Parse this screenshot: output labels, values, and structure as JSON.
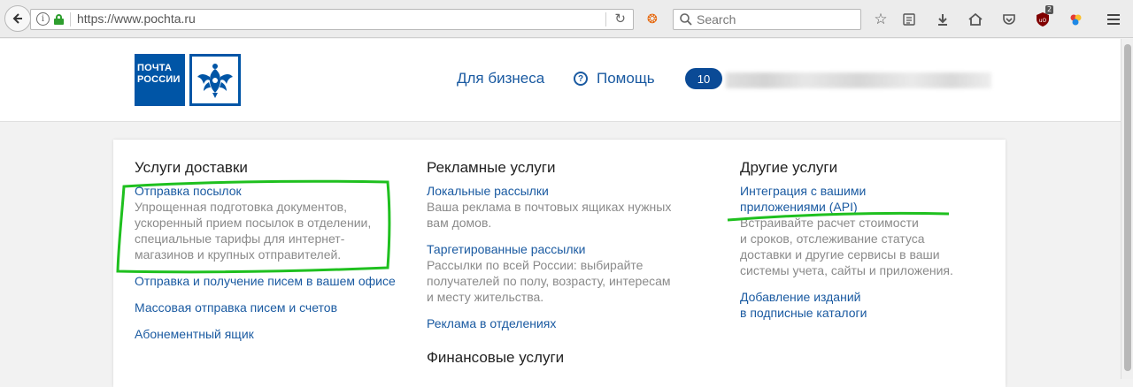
{
  "browser": {
    "url": "https://www.pochta.ru",
    "search_placeholder": "Search",
    "ublock_count": "2"
  },
  "header": {
    "logo_text_line1": "ПОЧТА",
    "logo_text_line2": "РОССИИ",
    "nav_business": "Для бизнеса",
    "nav_help": "Помощь",
    "notification_count": "10"
  },
  "columns": [
    {
      "heading": "Услуги доставки",
      "items": [
        {
          "label": "Отправка посылок",
          "desc": [
            "Упрощенная подготовка документов,",
            "ускоренный прием посылок в отделении,",
            "специальные тарифы для интернет-",
            "магазинов и крупных отправителей."
          ]
        },
        {
          "label": "Отправка и получение писем в вашем офисе"
        },
        {
          "label": "Массовая отправка писем и счетов"
        },
        {
          "label": "Абонементный ящик"
        }
      ]
    },
    {
      "heading": "Рекламные услуги",
      "items": [
        {
          "label": "Локальные рассылки",
          "desc": [
            "Ваша реклама в почтовых ящиках нужных",
            "вам домов."
          ]
        },
        {
          "label": "Таргетированные рассылки",
          "desc": [
            "Рассылки по всей России: выбирайте",
            "получателей по полу, возрасту, интересам",
            "и месту жительства."
          ]
        },
        {
          "label": "Реклама в отделениях"
        }
      ],
      "heading2": "Финансовые услуги"
    },
    {
      "heading": "Другие услуги",
      "items": [
        {
          "label_lines": [
            "Интеграция с вашими",
            "приложениями (API)"
          ],
          "desc": [
            "Встраивайте расчет стоимости",
            "и сроков, отслеживание статуса",
            "доставки и другие сервисы в ваши",
            "системы учета, сайты и приложения."
          ]
        },
        {
          "label_lines": [
            "Добавление изданий",
            "в подписные каталоги"
          ]
        }
      ]
    }
  ],
  "colors": {
    "brand": "#0055a6",
    "link": "#1a5aa1",
    "annotation": "#1fc01f"
  }
}
